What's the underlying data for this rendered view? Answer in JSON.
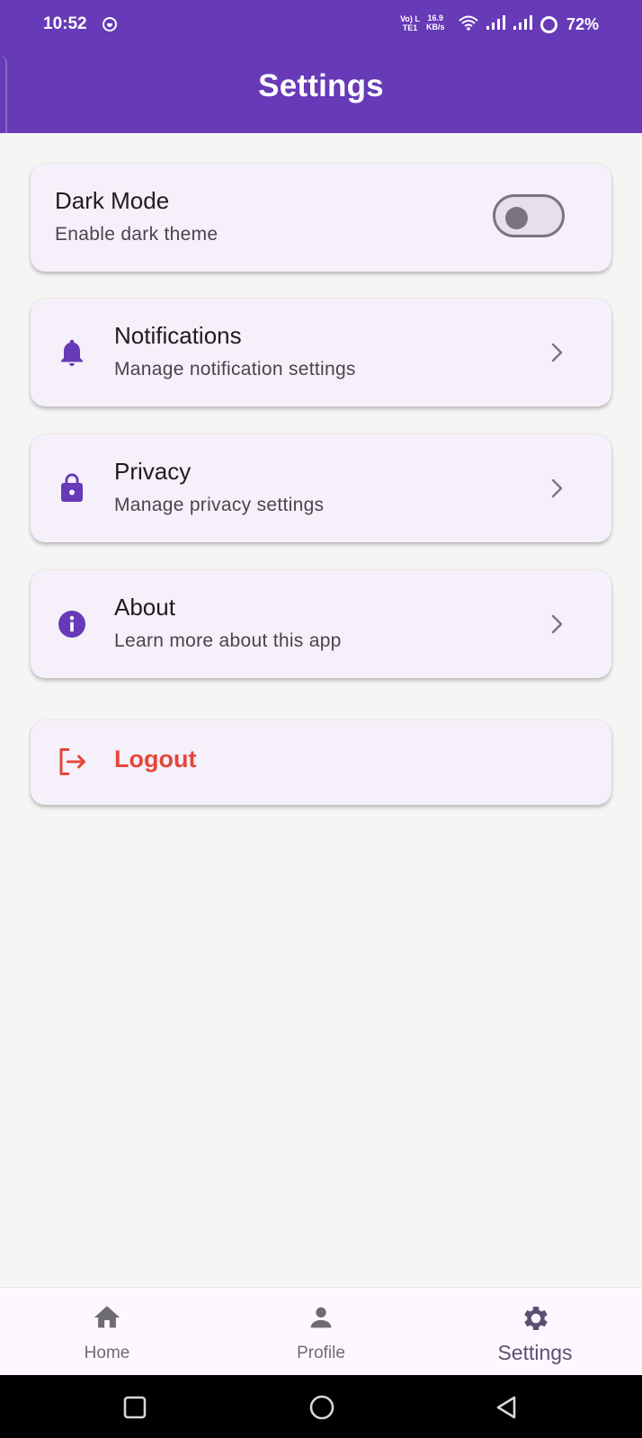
{
  "status_bar": {
    "time": "10:52",
    "network_line1": "Vo) LTE1",
    "speed_value": "16.9",
    "speed_unit": "KB/s",
    "battery": "72%"
  },
  "app_bar": {
    "title": "Settings",
    "color": "#673ab7"
  },
  "settings": {
    "dark_mode": {
      "title": "Dark Mode",
      "subtitle": "Enable dark theme",
      "enabled": false
    },
    "notifications": {
      "title": "Notifications",
      "subtitle": "Manage notification settings",
      "icon": "bell-icon"
    },
    "privacy": {
      "title": "Privacy",
      "subtitle": "Manage privacy settings",
      "icon": "lock-icon"
    },
    "about": {
      "title": "About",
      "subtitle": "Learn more about this app",
      "icon": "info-icon"
    },
    "logout": {
      "label": "Logout",
      "icon": "logout-icon",
      "color": "#e2473b"
    }
  },
  "bottom_nav": {
    "items": [
      {
        "label": "Home",
        "icon": "home-icon",
        "active": false
      },
      {
        "label": "Profile",
        "icon": "person-icon",
        "active": false
      },
      {
        "label": "Settings",
        "icon": "gear-icon",
        "active": true
      }
    ]
  },
  "colors": {
    "accent": "#673ab7",
    "card_bg": "#f5f0f9",
    "logout_red": "#e2473b",
    "background": "#f5f5f4"
  }
}
